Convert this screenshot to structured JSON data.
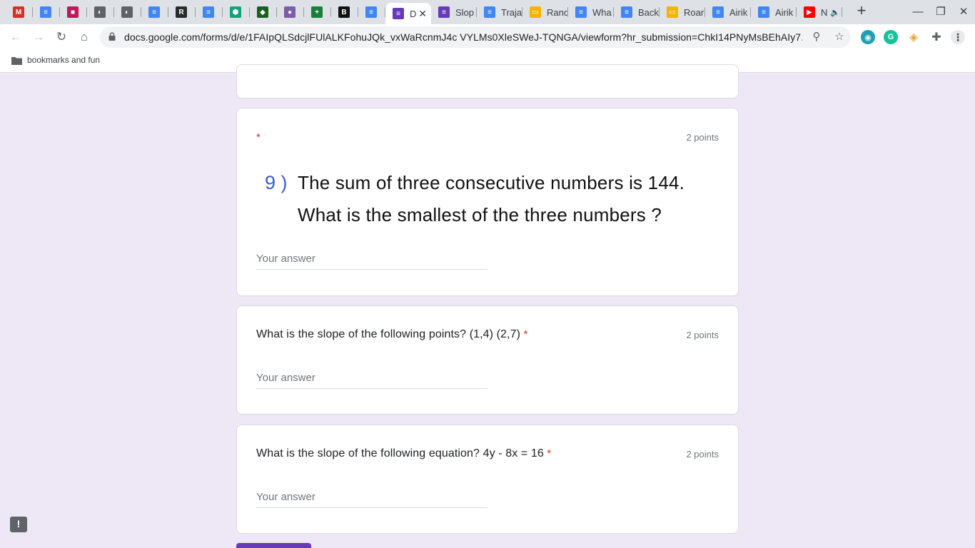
{
  "browser": {
    "tabs": [
      {
        "title": "",
        "icon": "gmail-icon",
        "color": "#d93025",
        "glyph": "M"
      },
      {
        "title": "",
        "icon": "docs-icon",
        "color": "#4285f4",
        "glyph": "≡"
      },
      {
        "title": "",
        "icon": "contact-icon",
        "color": "#c2185b",
        "glyph": "■"
      },
      {
        "title": "",
        "icon": "globe-icon",
        "color": "#5f6368",
        "glyph": "◐"
      },
      {
        "title": "",
        "icon": "globe-icon",
        "color": "#5f6368",
        "glyph": "◐"
      },
      {
        "title": "",
        "icon": "docs-icon",
        "color": "#4285f4",
        "glyph": "≡"
      },
      {
        "title": "",
        "icon": "r-logo-icon",
        "color": "#2b2b2b",
        "glyph": "R"
      },
      {
        "title": "",
        "icon": "docs-icon",
        "color": "#4285f4",
        "glyph": "≡"
      },
      {
        "title": "",
        "icon": "hexagon-icon",
        "color": "#12a37a",
        "glyph": "⬢"
      },
      {
        "title": "",
        "icon": "shield-logo-icon",
        "color": "#1b5e20",
        "glyph": "◆"
      },
      {
        "title": "",
        "icon": "mascot-icon",
        "color": "#7b5ea7",
        "glyph": "●"
      },
      {
        "title": "",
        "icon": "sheets-icon",
        "color": "#188038",
        "glyph": "+"
      },
      {
        "title": "",
        "icon": "b-logo-icon",
        "color": "#111111",
        "glyph": "B"
      },
      {
        "title": "",
        "icon": "docs-icon",
        "color": "#4285f4",
        "glyph": "≡"
      },
      {
        "title": "D",
        "icon": "forms-icon",
        "color": "#673ab7",
        "glyph": "≡",
        "active": true
      },
      {
        "title": "Slop",
        "icon": "forms-icon",
        "color": "#673ab7",
        "glyph": "≡"
      },
      {
        "title": "Traja",
        "icon": "docs-icon",
        "color": "#4285f4",
        "glyph": "≡"
      },
      {
        "title": "Rand",
        "icon": "slides-icon",
        "color": "#f4b400",
        "glyph": "▭"
      },
      {
        "title": "Wha",
        "icon": "docs-icon",
        "color": "#4285f4",
        "glyph": "≡"
      },
      {
        "title": "Back",
        "icon": "docs-icon",
        "color": "#4285f4",
        "glyph": "≡"
      },
      {
        "title": "Roar",
        "icon": "slides-icon",
        "color": "#f4b400",
        "glyph": "▭"
      },
      {
        "title": "Airik",
        "icon": "docs-icon",
        "color": "#4285f4",
        "glyph": "≡"
      },
      {
        "title": "Airik",
        "icon": "docs-icon",
        "color": "#4285f4",
        "glyph": "≡"
      },
      {
        "title": "N",
        "icon": "youtube-icon",
        "color": "#ff0000",
        "glyph": "▶",
        "audio": true
      }
    ],
    "url": "docs.google.com/forms/d/e/1FAIpQLSdcjlFUlALKFohuJQk_vxWaRcnmJ4c VYLMs0XleSWeJ-TQNGA/viewform?hr_submission=ChkI14PNyMsBEhAIy7...",
    "bookmark_folder": "bookmarks and  fun"
  },
  "form": {
    "q9": {
      "required_mark": "*",
      "points": "2 points",
      "number": "9 )",
      "line1": "The sum of three consecutive numbers is 144.",
      "line2": "What is the smallest of the three numbers ?",
      "placeholder": "Your answer"
    },
    "q10": {
      "title": "What is the slope of the following points? (1,4) (2,7)",
      "required_mark": "*",
      "points": "2 points",
      "placeholder": "Your answer"
    },
    "q11": {
      "title": "What is the slope of the following equation? 4y - 8x = 16",
      "required_mark": "*",
      "points": "2 points",
      "placeholder": "Your answer"
    }
  },
  "colors": {
    "accent": "#673ab7",
    "background": "#ede7f6",
    "required": "#d93025",
    "question_number": "#3a5ec9"
  }
}
